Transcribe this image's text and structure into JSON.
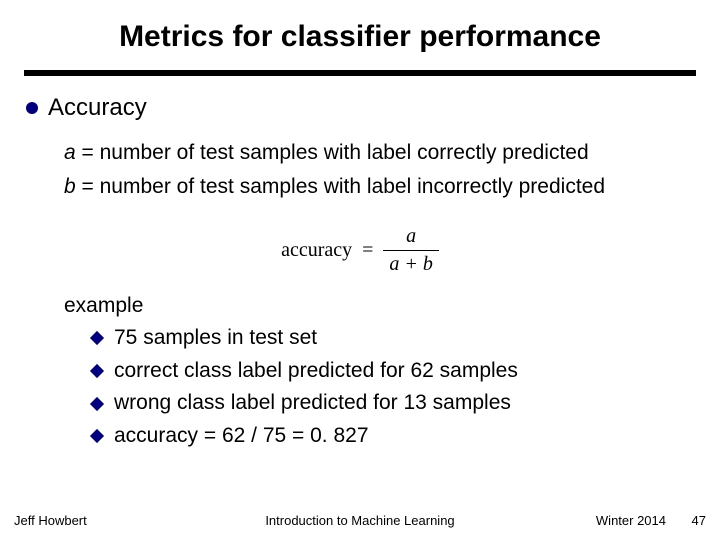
{
  "title": "Metrics for classifier performance",
  "bullet": "Accuracy",
  "defs": {
    "a_var": "a",
    "a_rest": " = number of test samples with label correctly predicted",
    "b_var": "b",
    "b_rest": " = number of test samples with label incorrectly predicted"
  },
  "formula": {
    "lhs": "accuracy",
    "eq": "=",
    "num": "a",
    "den": "a + b"
  },
  "example": {
    "heading": "example",
    "items": [
      "75 samples in test set",
      "correct class label predicted for 62 samples",
      "wrong class label predicted for 13 samples",
      "accuracy = 62 / 75 = 0. 827"
    ]
  },
  "footer": {
    "author": "Jeff Howbert",
    "course": "Introduction to Machine Learning",
    "term": "Winter 2014",
    "page": "47"
  }
}
